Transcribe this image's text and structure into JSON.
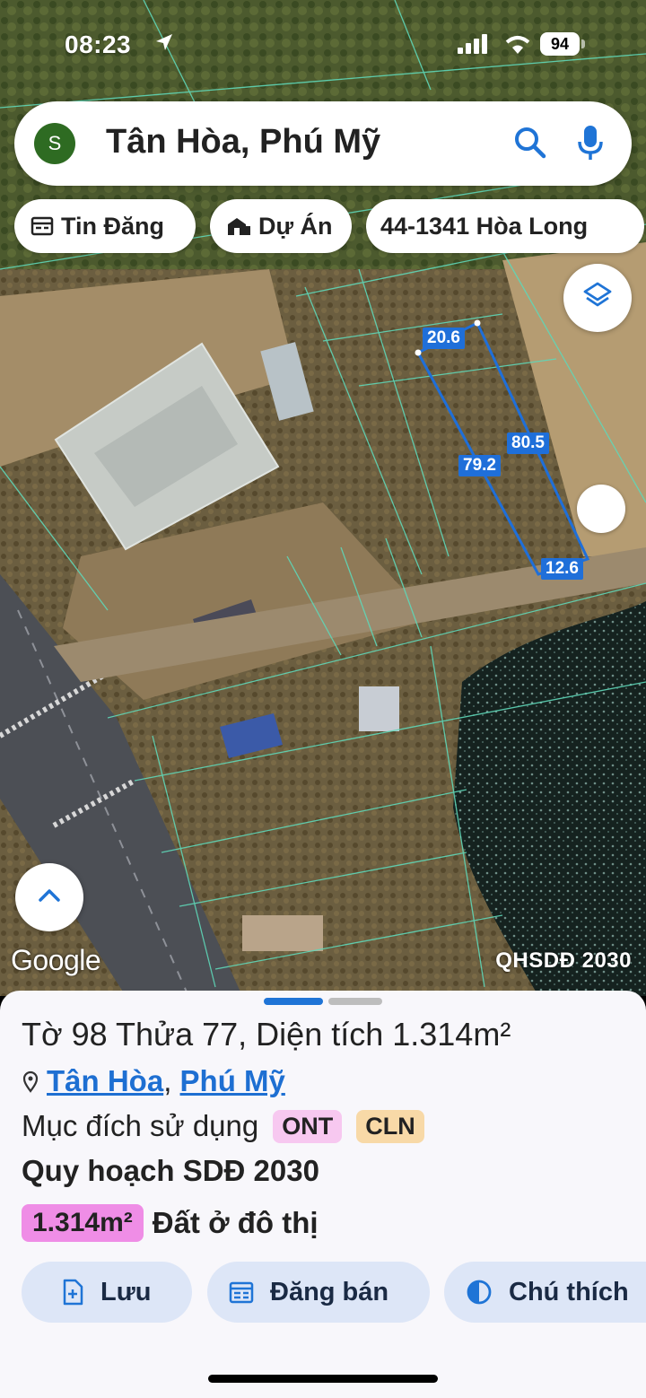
{
  "status": {
    "time": "08:23",
    "battery": "94"
  },
  "search": {
    "avatar_letter": "S",
    "title": "Tân Hòa, Phú Mỹ"
  },
  "chips": [
    {
      "label": "Tin Đăng",
      "icon": "newspaper-icon"
    },
    {
      "label": "Dự Án",
      "icon": "building-icon"
    },
    {
      "label": "44-1341 Hòa Long",
      "icon": ""
    }
  ],
  "map": {
    "dimensions": [
      "20.6",
      "80.5",
      "79.2",
      "12.6"
    ],
    "google_logo": "Google",
    "plan_label": "QHSDĐ 2030"
  },
  "sheet": {
    "title": "Tờ 98 Thửa 77, Diện tích 1.314m²",
    "address_ward": "Tân Hòa",
    "address_separator": ",",
    "address_city": "Phú Mỹ",
    "purpose_label": "Mục đích sử dụng",
    "purpose_codes": [
      "ONT",
      "CLN"
    ],
    "plan_title": "Quy hoạch SDĐ 2030",
    "plan_area": "1.314m²",
    "plan_land_type": "Đất ở đô thị",
    "actions": [
      {
        "label": "Lưu",
        "icon": "bookmark-add-icon"
      },
      {
        "label": "Đăng bán",
        "icon": "calendar-icon"
      },
      {
        "label": "Chú thích",
        "icon": "contrast-icon"
      }
    ]
  },
  "colors": {
    "accent": "#1f6fd9",
    "ont": "#f7c8f0",
    "cln": "#f8d9a7",
    "area": "#ef8de6"
  }
}
